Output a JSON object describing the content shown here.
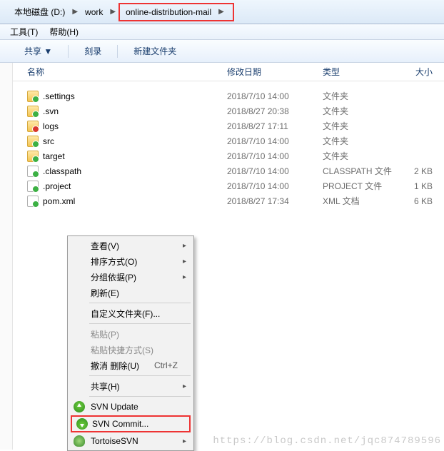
{
  "breadcrumb": {
    "root": "本地磁盘 (D:)",
    "mid": "work",
    "leaf": "online-distribution-mail"
  },
  "menubar": {
    "tools": "工具(T)",
    "help": "帮助(H)"
  },
  "toolbar": {
    "share": "共享 ▼",
    "burn": "刻录",
    "newfolder": "新建文件夹"
  },
  "columns": {
    "name": "名称",
    "date": "修改日期",
    "type": "类型",
    "size": "大小"
  },
  "files": [
    {
      "name": ".settings",
      "date": "2018/7/10 14:00",
      "type": "文件夹",
      "size": ""
    },
    {
      "name": ".svn",
      "date": "2018/8/27 20:38",
      "type": "文件夹",
      "size": ""
    },
    {
      "name": "logs",
      "date": "2018/8/27 17:11",
      "type": "文件夹",
      "size": ""
    },
    {
      "name": "src",
      "date": "2018/7/10 14:00",
      "type": "文件夹",
      "size": ""
    },
    {
      "name": "target",
      "date": "2018/7/10 14:00",
      "type": "文件夹",
      "size": ""
    },
    {
      "name": ".classpath",
      "date": "2018/7/10 14:00",
      "type": "CLASSPATH 文件",
      "size": "2 KB"
    },
    {
      "name": ".project",
      "date": "2018/7/10 14:00",
      "type": "PROJECT 文件",
      "size": "1 KB"
    },
    {
      "name": "pom.xml",
      "date": "2018/8/27 17:34",
      "type": "XML 文档",
      "size": "6 KB"
    }
  ],
  "ctx": {
    "view": "查看(V)",
    "sort": "排序方式(O)",
    "group": "分组依据(P)",
    "refresh": "刷新(E)",
    "customize": "自定义文件夹(F)...",
    "paste": "粘贴(P)",
    "pasteShortcut": "粘贴快捷方式(S)",
    "undo": "撤消 删除(U)",
    "undo_shortcut": "Ctrl+Z",
    "shareWith": "共享(H)",
    "svnUpdate": "SVN Update",
    "svnCommit": "SVN Commit...",
    "tortoise": "TortoiseSVN"
  },
  "watermark": "https://blog.csdn.net/jqc874789596"
}
